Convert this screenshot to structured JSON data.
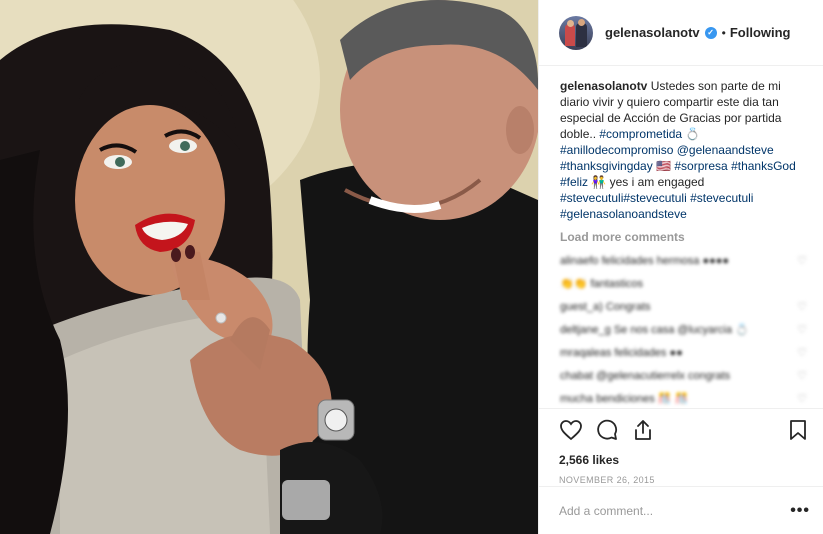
{
  "header": {
    "username": "gelenasolanotv",
    "verified_icon": "✓",
    "separator": "•",
    "follow_status": "Following"
  },
  "caption": {
    "username": "gelenasolanotv",
    "text": "Ustedes son parte de mi diario vivir y quiero compartir este dia tan especial de Acción de Gracias por partida doble.. ",
    "tag1": "#comprometida",
    "after1": " 💍 ",
    "tag2": "#anillodecompromiso",
    "after2": " ",
    "mention": "@gelenaandsteve",
    "after3": " ",
    "tag3": "#thanksgivingday",
    "after4": " 🇺🇸 ",
    "tag4": "#sorpresa",
    "after5": " ",
    "tag5": "#thanksGod",
    "after6": " ",
    "tag6": "#feliz",
    "after7": " 👫 yes i am engaged ",
    "tag7": "#stevecutuli#stevecutuli",
    "after8": " ",
    "tag8": "#stevecutuli",
    "after9": " ",
    "tag9": "#gelenasolanoandsteve"
  },
  "load_more": "Load more comments",
  "blurred_comments": [
    {
      "text": "alinaefo felicidades hermosa ●●●●",
      "heart": "♡"
    },
    {
      "text": "👏👏 fantasticos",
      "heart": ""
    },
    {
      "text": "guest_a) Congrats",
      "heart": "♡"
    },
    {
      "text": "deltjane_g Se nos casa @lucyarcia 💍",
      "heart": "♡"
    },
    {
      "text": "mraqaleas felicidades ●●",
      "heart": "♡"
    },
    {
      "text": "chabat @gelenacutierrelx congrats",
      "heart": "♡"
    },
    {
      "text": "mucha bendiciones 🎊 🎊",
      "heart": "♡"
    }
  ],
  "actions": {
    "like_icon": "heart-icon",
    "comment_icon": "comment-icon",
    "share_icon": "share-icon",
    "save_icon": "bookmark-icon"
  },
  "likes": "2,566 likes",
  "date": "NOVEMBER 26, 2015",
  "add_comment": {
    "placeholder": "Add a comment...",
    "more": "•••"
  },
  "colors": {
    "tag": "#003569",
    "verified": "#3897f0",
    "muted": "#999999"
  }
}
